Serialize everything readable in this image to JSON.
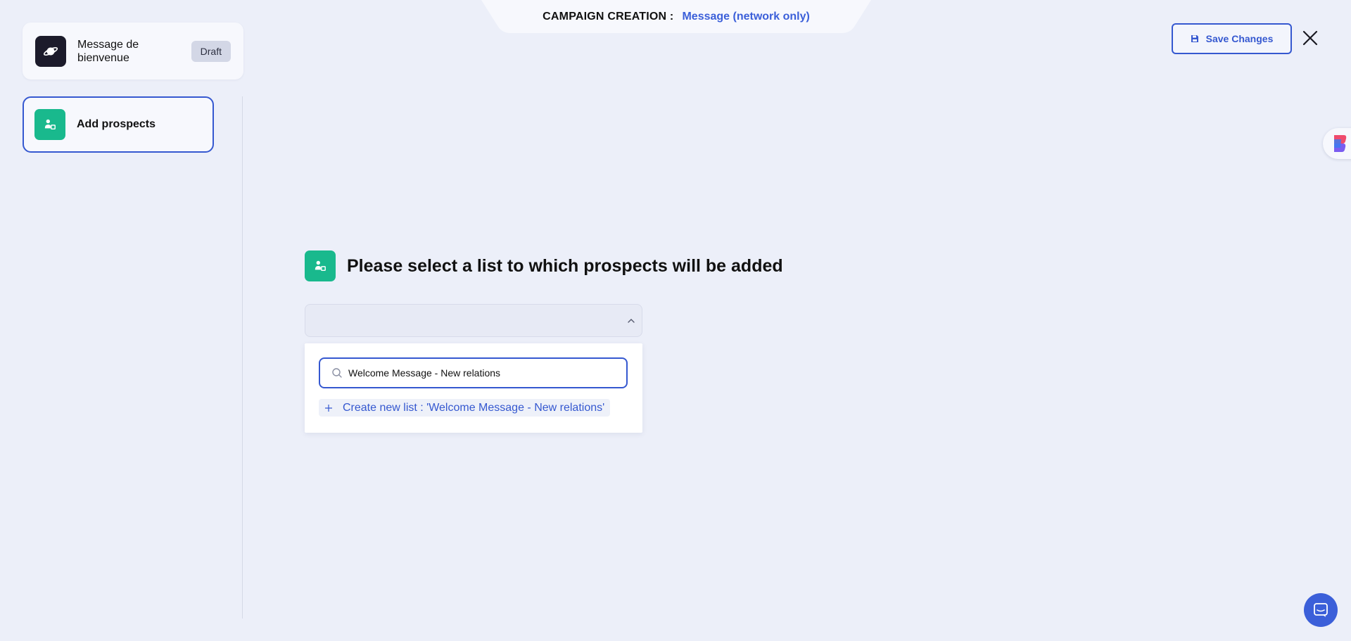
{
  "header": {
    "prefix": "CAMPAIGN CREATION :",
    "campaign_type": "Message (network only)"
  },
  "campaign": {
    "title": "Message de bienvenue",
    "status": "Draft",
    "icon": "planet-icon"
  },
  "steps": [
    {
      "label": "Add prospects",
      "icon": "person-list-icon"
    }
  ],
  "toolbar": {
    "save_label": "Save Changes",
    "save_icon": "floppy-icon",
    "close_icon": "close-icon"
  },
  "main": {
    "title": "Please select a list to which prospects will be added",
    "select_value": "",
    "search_value": "Welcome Message - New relations",
    "create_option_label": "Create new list : 'Welcome Message - New relations'"
  },
  "colors": {
    "accent": "#3558d0",
    "green": "#19b98d",
    "background": "#eceff9",
    "dark": "#1c1b2b"
  }
}
